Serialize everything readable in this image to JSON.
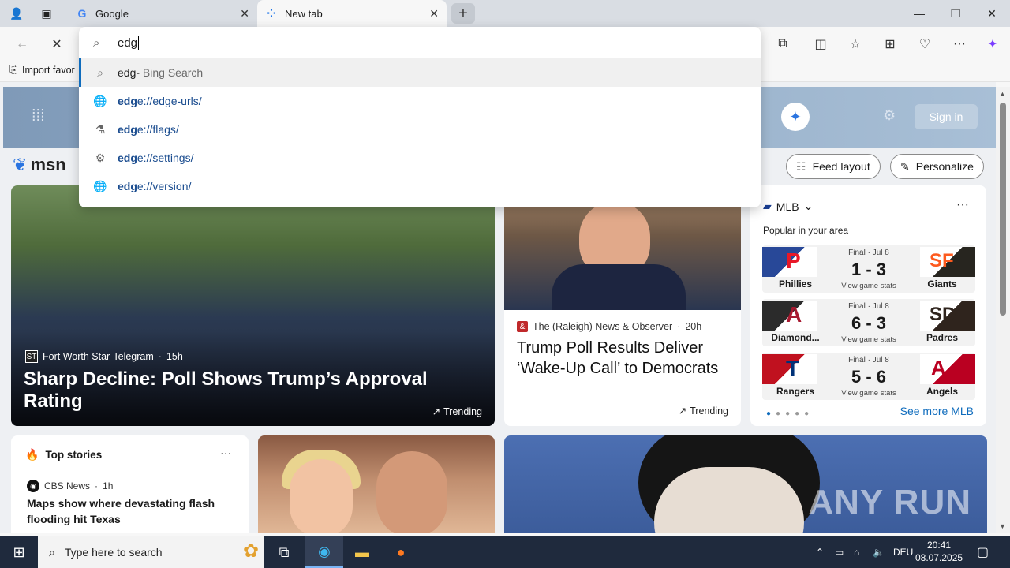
{
  "tabs": [
    {
      "title": "Google",
      "favicon": "google-icon"
    },
    {
      "title": "New tab",
      "favicon": "loading-icon"
    }
  ],
  "omnibox": {
    "query": "edg",
    "suggestions": [
      {
        "match": "edg",
        "rest": "",
        "suffix": " - Bing Search",
        "icon": "search-icon"
      },
      {
        "match": "edg",
        "rest": "e://edge-urls/",
        "suffix": "",
        "icon": "globe-icon"
      },
      {
        "match": "edg",
        "rest": "e://flags/",
        "suffix": "",
        "icon": "flask-icon"
      },
      {
        "match": "edg",
        "rest": "e://settings/",
        "suffix": "",
        "icon": "gear-icon"
      },
      {
        "match": "edg",
        "rest": "e://version/",
        "suffix": "",
        "icon": "globe-icon"
      }
    ]
  },
  "favorites_bar": {
    "import_label": "Import favor"
  },
  "msn": {
    "logo": "msn",
    "sign_in": "Sign in",
    "feed_layout": "Feed layout",
    "personalize": "Personalize"
  },
  "hero": {
    "source": "Fort Worth Star-Telegram",
    "age": "15h",
    "headline": "Sharp Decline: Poll Shows Trump’s Approval Rating",
    "trending": "Trending"
  },
  "card2": {
    "source": "The (Raleigh) News & Observer",
    "age": "20h",
    "headline": "Trump Poll Results Deliver ‘Wake-Up Call’ to Democrats",
    "trending": "Trending"
  },
  "mlb": {
    "title": "MLB",
    "subtitle": "Popular in your area",
    "see_more": "See more MLB",
    "games": [
      {
        "status": "Final · Jul 8",
        "score": "1 - 3",
        "left": "Phillies",
        "right": "Giants",
        "left_color": "#284898",
        "right_color": "#27251f",
        "left_letter": "P",
        "right_letter": "SF",
        "stats": "View game stats"
      },
      {
        "status": "Final · Jul 8",
        "score": "6 - 3",
        "left": "Diamond...",
        "right": "Padres",
        "left_color": "#2b2b2b",
        "right_color": "#2f241d",
        "left_letter": "A",
        "right_letter": "SD",
        "stats": "View game stats"
      },
      {
        "status": "Final · Jul 8",
        "score": "5 - 6",
        "left": "Rangers",
        "right": "Angels",
        "left_color": "#c0111f",
        "right_color": "#ba0021",
        "left_letter": "T",
        "right_letter": "A",
        "stats": "View game stats"
      }
    ]
  },
  "top_stories": {
    "title": "Top stories",
    "source": "CBS News",
    "age": "1h",
    "headline": "Maps show where devastating flash flooding hit Texas"
  },
  "watermark": "ANY RUN",
  "taskbar": {
    "search_placeholder": "Type here to search",
    "language": "DEU",
    "time": "20:41",
    "date": "08.07.2025"
  }
}
